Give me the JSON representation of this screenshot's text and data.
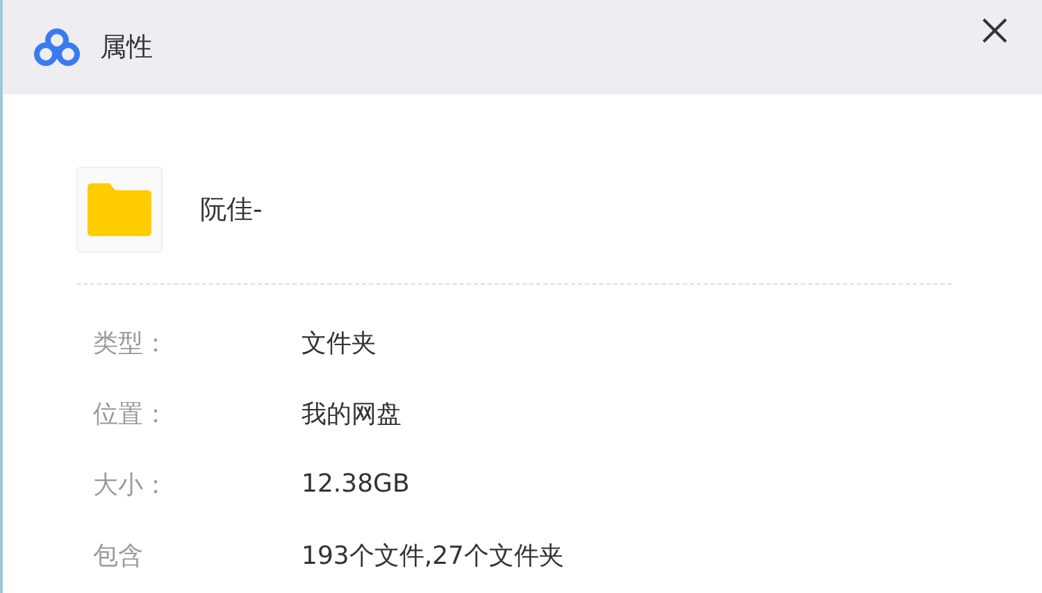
{
  "window": {
    "title": "属性"
  },
  "item": {
    "name": "阮佳-",
    "kind": "folder"
  },
  "properties": [
    {
      "label": "类型：",
      "value": "文件夹"
    },
    {
      "label": "位置：",
      "value": "我的网盘"
    },
    {
      "label": "大小：",
      "value": "12.38GB"
    },
    {
      "label": "包含",
      "value": "193个文件,27个文件夹"
    }
  ]
}
